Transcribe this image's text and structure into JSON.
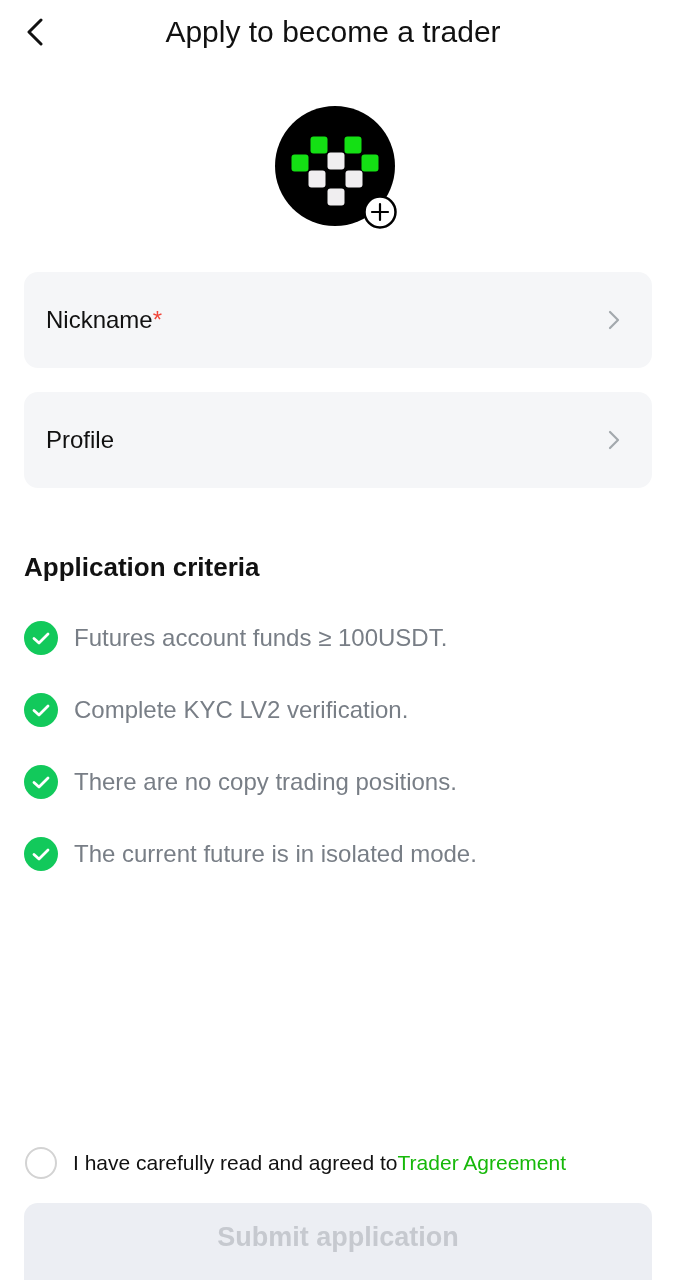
{
  "header": {
    "title": "Apply to become a trader"
  },
  "fields": [
    {
      "label": "Nickname",
      "required_mark": "*"
    },
    {
      "label": "Profile"
    }
  ],
  "criteria": {
    "title": "Application criteria",
    "items": [
      {
        "text": "Futures account funds ≥ 100USDT.",
        "met": true
      },
      {
        "text": "Complete KYC LV2 verification.",
        "met": true
      },
      {
        "text": "There are no copy trading positions.",
        "met": true
      },
      {
        "text": "The current future is in isolated mode.",
        "met": true
      }
    ]
  },
  "agreement": {
    "text": "I have carefully read and agreed to",
    "link": "Trader Agreement",
    "checked": false
  },
  "submit": {
    "label": "Submit application",
    "disabled": true
  }
}
